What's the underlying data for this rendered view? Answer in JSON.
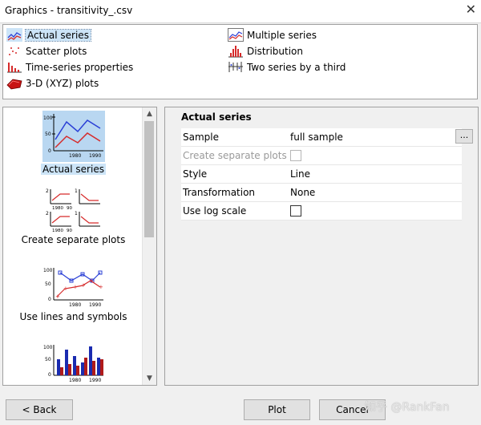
{
  "window": {
    "title": "Graphics - transitivity_.csv",
    "close_glyph": "✕"
  },
  "graph_types": [
    {
      "label": "Actual series",
      "icon": "actual-series-icon",
      "selected": true
    },
    {
      "label": "Scatter plots",
      "icon": "scatter-plot-icon"
    },
    {
      "label": "Time-series properties",
      "icon": "time-series-icon"
    },
    {
      "label": "3-D (XYZ) plots",
      "icon": "3d-plot-icon"
    },
    {
      "label": "Multiple series",
      "icon": "multiple-series-icon"
    },
    {
      "label": "Distribution",
      "icon": "distribution-icon"
    },
    {
      "label": "Two series by a third",
      "icon": "two-series-icon"
    }
  ],
  "thumbnails": [
    {
      "caption": "Actual series",
      "selected": true,
      "ticks_y": [
        "100",
        "50",
        "0"
      ],
      "ticks_x": [
        "1980",
        "1990"
      ]
    },
    {
      "caption": "Create separate plots",
      "ticks_y": [
        "2",
        "1",
        "2",
        "1"
      ],
      "ticks_x": [
        "1980",
        "90",
        "1980",
        "90"
      ]
    },
    {
      "caption": "Use lines and symbols",
      "ticks_y": [
        "100",
        "50",
        "0"
      ],
      "ticks_x": [
        "1980",
        "1990"
      ]
    },
    {
      "caption": "",
      "ticks_y": [
        "100",
        "50",
        "0"
      ],
      "ticks_x": [
        "1980",
        "1990"
      ]
    }
  ],
  "scroll": {
    "up": "▲",
    "down": "▼"
  },
  "properties": {
    "header": "Actual series",
    "rows": [
      {
        "key": "Sample",
        "value": "full sample",
        "type": "text"
      },
      {
        "key": "Create separate plots",
        "type": "checkbox",
        "disabled": true
      },
      {
        "key": "Style",
        "value": "Line",
        "type": "text"
      },
      {
        "key": "Transformation",
        "value": "None",
        "type": "text"
      },
      {
        "key": "Use log scale",
        "type": "checkbox"
      }
    ],
    "browse_label": "..."
  },
  "buttons": {
    "back": "< Back",
    "plot": "Plot",
    "cancel": "Cancel"
  },
  "watermark": "知乎 @RankFan",
  "colors": {
    "selection": "#cce4f7",
    "blue_series": "#2a3fd6",
    "red_series": "#d62a2a"
  }
}
